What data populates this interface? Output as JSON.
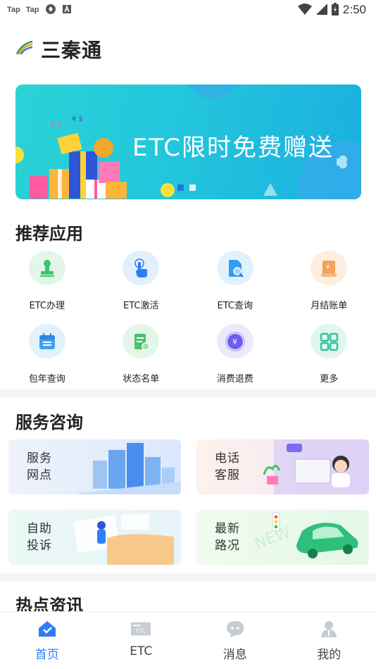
{
  "status_bar": {
    "left_labels": [
      "Tap",
      "Tap"
    ],
    "time": "2:50"
  },
  "app": {
    "title": "三秦通"
  },
  "banner": {
    "text": "ETC限时免费赠送"
  },
  "recommended": {
    "title": "推荐应用",
    "items": [
      {
        "label": "ETC办理",
        "icon": "stamp-icon",
        "color": "#3dc46a"
      },
      {
        "label": "ETC激活",
        "icon": "tap-hand-icon",
        "color": "#2f7cf6"
      },
      {
        "label": "ETC查询",
        "icon": "document-search-icon",
        "color": "#2f9cf6"
      },
      {
        "label": "月结账单",
        "icon": "bill-icon",
        "color": "#f5a15a"
      },
      {
        "label": "包年查询",
        "icon": "calendar-icon",
        "color": "#39a6f2"
      },
      {
        "label": "状态名单",
        "icon": "list-status-icon",
        "color": "#4cc26a"
      },
      {
        "label": "消费退费",
        "icon": "yuan-coin-icon",
        "color": "#6f5cf0"
      },
      {
        "label": "更多",
        "icon": "grid-more-icon",
        "color": "#2fc39a"
      }
    ]
  },
  "services": {
    "title": "服务咨询",
    "cards": [
      {
        "label": "服务网点",
        "icon": "city-buildings-icon"
      },
      {
        "label": "电话客服",
        "icon": "customer-service-icon"
      },
      {
        "label": "自助投诉",
        "icon": "complaint-icon"
      },
      {
        "label": "最新路况",
        "icon": "road-car-icon"
      }
    ]
  },
  "news": {
    "title": "热点资讯"
  },
  "bottom_nav": {
    "items": [
      {
        "label": "首页",
        "icon": "home-icon",
        "active": true
      },
      {
        "label": "ETC",
        "icon": "etc-card-icon",
        "active": false
      },
      {
        "label": "消息",
        "icon": "message-icon",
        "active": false
      },
      {
        "label": "我的",
        "icon": "profile-icon",
        "active": false
      }
    ]
  },
  "colors": {
    "accent": "#2f7cf6",
    "banner": "#23c6dc"
  }
}
